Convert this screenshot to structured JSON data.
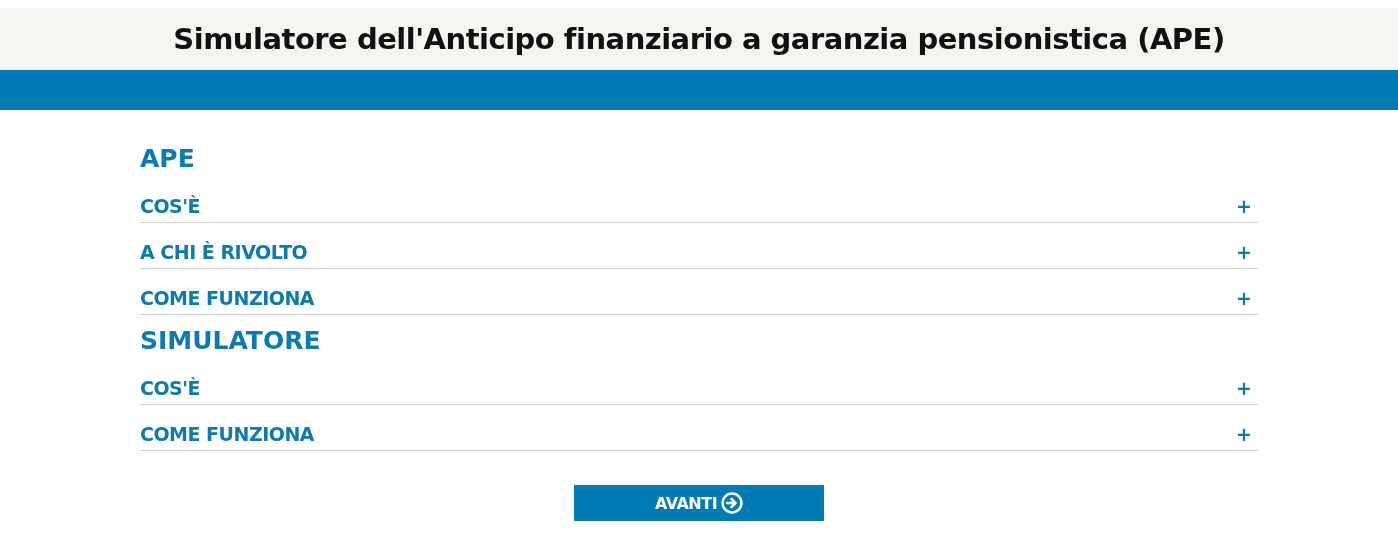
{
  "header": {
    "title": "Simulatore dell'Anticipo finanziario a garanzia pensionistica (APE)"
  },
  "sections": [
    {
      "title": "APE",
      "items": [
        {
          "label": "COS'È",
          "toggle": "+",
          "expanded": false
        },
        {
          "label": "A CHI È RIVOLTO",
          "toggle": "+",
          "expanded": false
        },
        {
          "label": "COME FUNZIONA",
          "toggle": "+",
          "expanded": false
        }
      ]
    },
    {
      "title": "SIMULATORE",
      "items": [
        {
          "label": "COS'È",
          "toggle": "+",
          "expanded": false
        },
        {
          "label": "COME FUNZIONA",
          "toggle": "+",
          "expanded": false
        }
      ]
    }
  ],
  "next_button": {
    "label": "AVANTI"
  }
}
